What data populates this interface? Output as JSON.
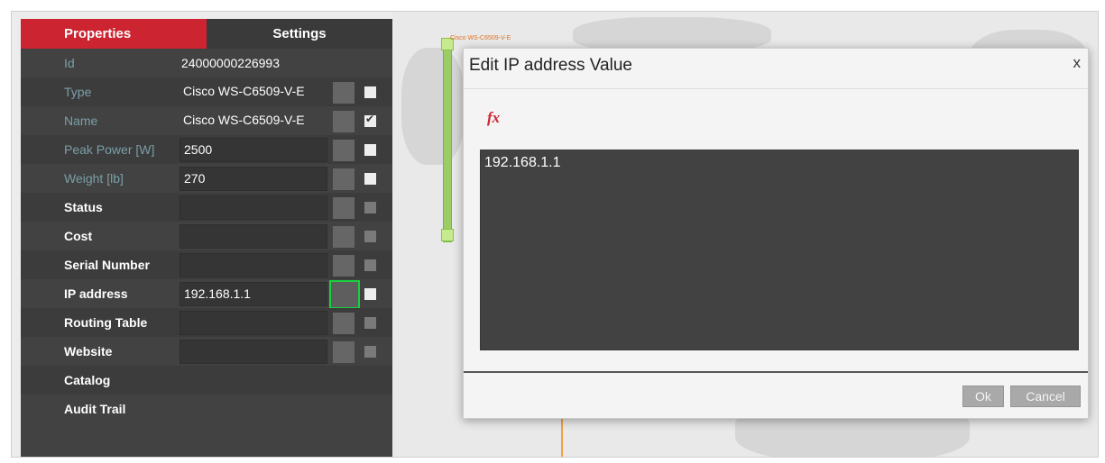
{
  "tabs": {
    "properties": "Properties",
    "settings": "Settings"
  },
  "properties": [
    {
      "label": "Id",
      "value": "24000000226993"
    },
    {
      "label": "Type",
      "value": "Cisco WS-C6509-V-E"
    },
    {
      "label": "Name",
      "value": "Cisco WS-C6509-V-E"
    },
    {
      "label": "Peak Power [W]",
      "value": "2500"
    },
    {
      "label": "Weight [lb]",
      "value": "270"
    },
    {
      "label": "Status",
      "value": ""
    },
    {
      "label": "Cost",
      "value": ""
    },
    {
      "label": "Serial Number",
      "value": ""
    },
    {
      "label": "IP address",
      "value": "192.168.1.1"
    },
    {
      "label": "Routing Table",
      "value": ""
    },
    {
      "label": "Website",
      "value": ""
    },
    {
      "label": "Catalog",
      "value": ""
    },
    {
      "label": "Audit Trail",
      "value": ""
    }
  ],
  "map": {
    "node_label": "Cisco WS-C6509-V-E"
  },
  "dialog": {
    "title": "Edit IP address Value",
    "close": "x",
    "fx_icon": "fx",
    "expression": "192.168.1.1",
    "ok": "Ok",
    "cancel": "Cancel"
  },
  "colors": {
    "accent_red": "#cc2431",
    "panel_bg": "#424242",
    "highlight_green": "#18d13c",
    "field_label_teal": "#7a9fa8"
  }
}
